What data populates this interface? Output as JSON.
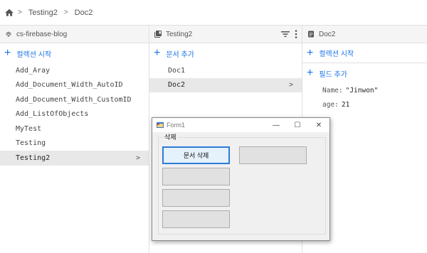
{
  "breadcrumb": {
    "items": [
      "Testing2",
      "Doc2"
    ]
  },
  "column_project": {
    "title": "cs-firebase-blog",
    "action_label": "컬렉션 시작",
    "collections": [
      "Add_Aray",
      "Add_Document_Width_AutoID",
      "Add_Document_Width_CustomID",
      "Add_ListOfObjects",
      "MyTest",
      "Testing",
      "Testing2"
    ],
    "selected": "Testing2"
  },
  "column_collection": {
    "title": "Testing2",
    "action_label": "문서 추가",
    "documents": [
      "Doc1",
      "Doc2"
    ],
    "selected": "Doc2"
  },
  "column_document": {
    "title": "Doc2",
    "start_collection_label": "컬렉션 시작",
    "add_field_label": "필드 추가",
    "fields": [
      {
        "key": "Name:",
        "value": "\"Jinwon\""
      },
      {
        "key": "age:",
        "value": "21"
      }
    ]
  },
  "form1": {
    "title": "Form1",
    "group_label": "삭제",
    "delete_button_label": "문서 삭제"
  },
  "colors": {
    "accent": "#1a73e8",
    "selected_row": "#e8e8e8",
    "dialog_bg": "#f0f0f0"
  }
}
